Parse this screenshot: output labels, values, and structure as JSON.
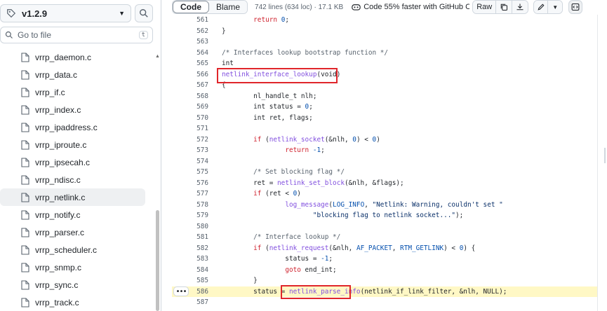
{
  "sidebar": {
    "branch": "v1.2.9",
    "goto_placeholder": "Go to file",
    "goto_shortcut": "t",
    "files": [
      "vrrp_daemon.c",
      "vrrp_data.c",
      "vrrp_if.c",
      "vrrp_index.c",
      "vrrp_ipaddress.c",
      "vrrp_iproute.c",
      "vrrp_ipsecah.c",
      "vrrp_ndisc.c",
      "vrrp_netlink.c",
      "vrrp_notify.c",
      "vrrp_parser.c",
      "vrrp_scheduler.c",
      "vrrp_snmp.c",
      "vrrp_sync.c",
      "vrrp_track.c"
    ],
    "selected_file": "vrrp_netlink.c"
  },
  "toolbar": {
    "code_tab": "Code",
    "blame_tab": "Blame",
    "meta": "742 lines (634 loc) · 17.1 KB",
    "copilot": "Code 55% faster with GitHub Copilot",
    "raw": "Raw"
  },
  "code": {
    "highlighted_line": "586",
    "lines": [
      {
        "n": "561",
        "src": "        return 0;"
      },
      {
        "n": "562",
        "src": "}"
      },
      {
        "n": "563",
        "src": ""
      },
      {
        "n": "564",
        "src": "/* Interfaces lookup bootstrap function */"
      },
      {
        "n": "565",
        "src": "int"
      },
      {
        "n": "566",
        "src": "netlink_interface_lookup(void)"
      },
      {
        "n": "567",
        "src": "{"
      },
      {
        "n": "568",
        "src": "        nl_handle_t nlh;"
      },
      {
        "n": "569",
        "src": "        int status = 0;"
      },
      {
        "n": "570",
        "src": "        int ret, flags;"
      },
      {
        "n": "571",
        "src": ""
      },
      {
        "n": "572",
        "src": "        if (netlink_socket(&nlh, 0) < 0)"
      },
      {
        "n": "573",
        "src": "                return -1;"
      },
      {
        "n": "574",
        "src": ""
      },
      {
        "n": "575",
        "src": "        /* Set blocking flag */"
      },
      {
        "n": "576",
        "src": "        ret = netlink_set_block(&nlh, &flags);"
      },
      {
        "n": "577",
        "src": "        if (ret < 0)"
      },
      {
        "n": "578",
        "src": "                log_message(LOG_INFO, \"Netlink: Warning, couldn't set \""
      },
      {
        "n": "579",
        "src": "                       \"blocking flag to netlink socket...\");"
      },
      {
        "n": "580",
        "src": ""
      },
      {
        "n": "581",
        "src": "        /* Interface lookup */"
      },
      {
        "n": "582",
        "src": "        if (netlink_request(&nlh, AF_PACKET, RTM_GETLINK) < 0) {"
      },
      {
        "n": "583",
        "src": "                status = -1;"
      },
      {
        "n": "584",
        "src": "                goto end_int;"
      },
      {
        "n": "585",
        "src": "        }"
      },
      {
        "n": "586",
        "src": "        status = netlink_parse_info(netlink_if_link_filter, &nlh, NULL);"
      },
      {
        "n": "587",
        "src": ""
      }
    ]
  },
  "icons": {
    "tag": "tag-icon",
    "search": "search-icon",
    "file": "file-icon",
    "copilot": "copilot-icon",
    "copy": "copy-icon",
    "download": "download-icon",
    "edit": "pencil-icon",
    "symbols": "symbols-panel-icon"
  },
  "colors": {
    "keyword": "#cf222e",
    "function": "#8250df",
    "number": "#0550ae",
    "string": "#0a3069",
    "comment": "#59636e",
    "annotation_box": "#e0262b",
    "highlight": "#fff8c5"
  }
}
